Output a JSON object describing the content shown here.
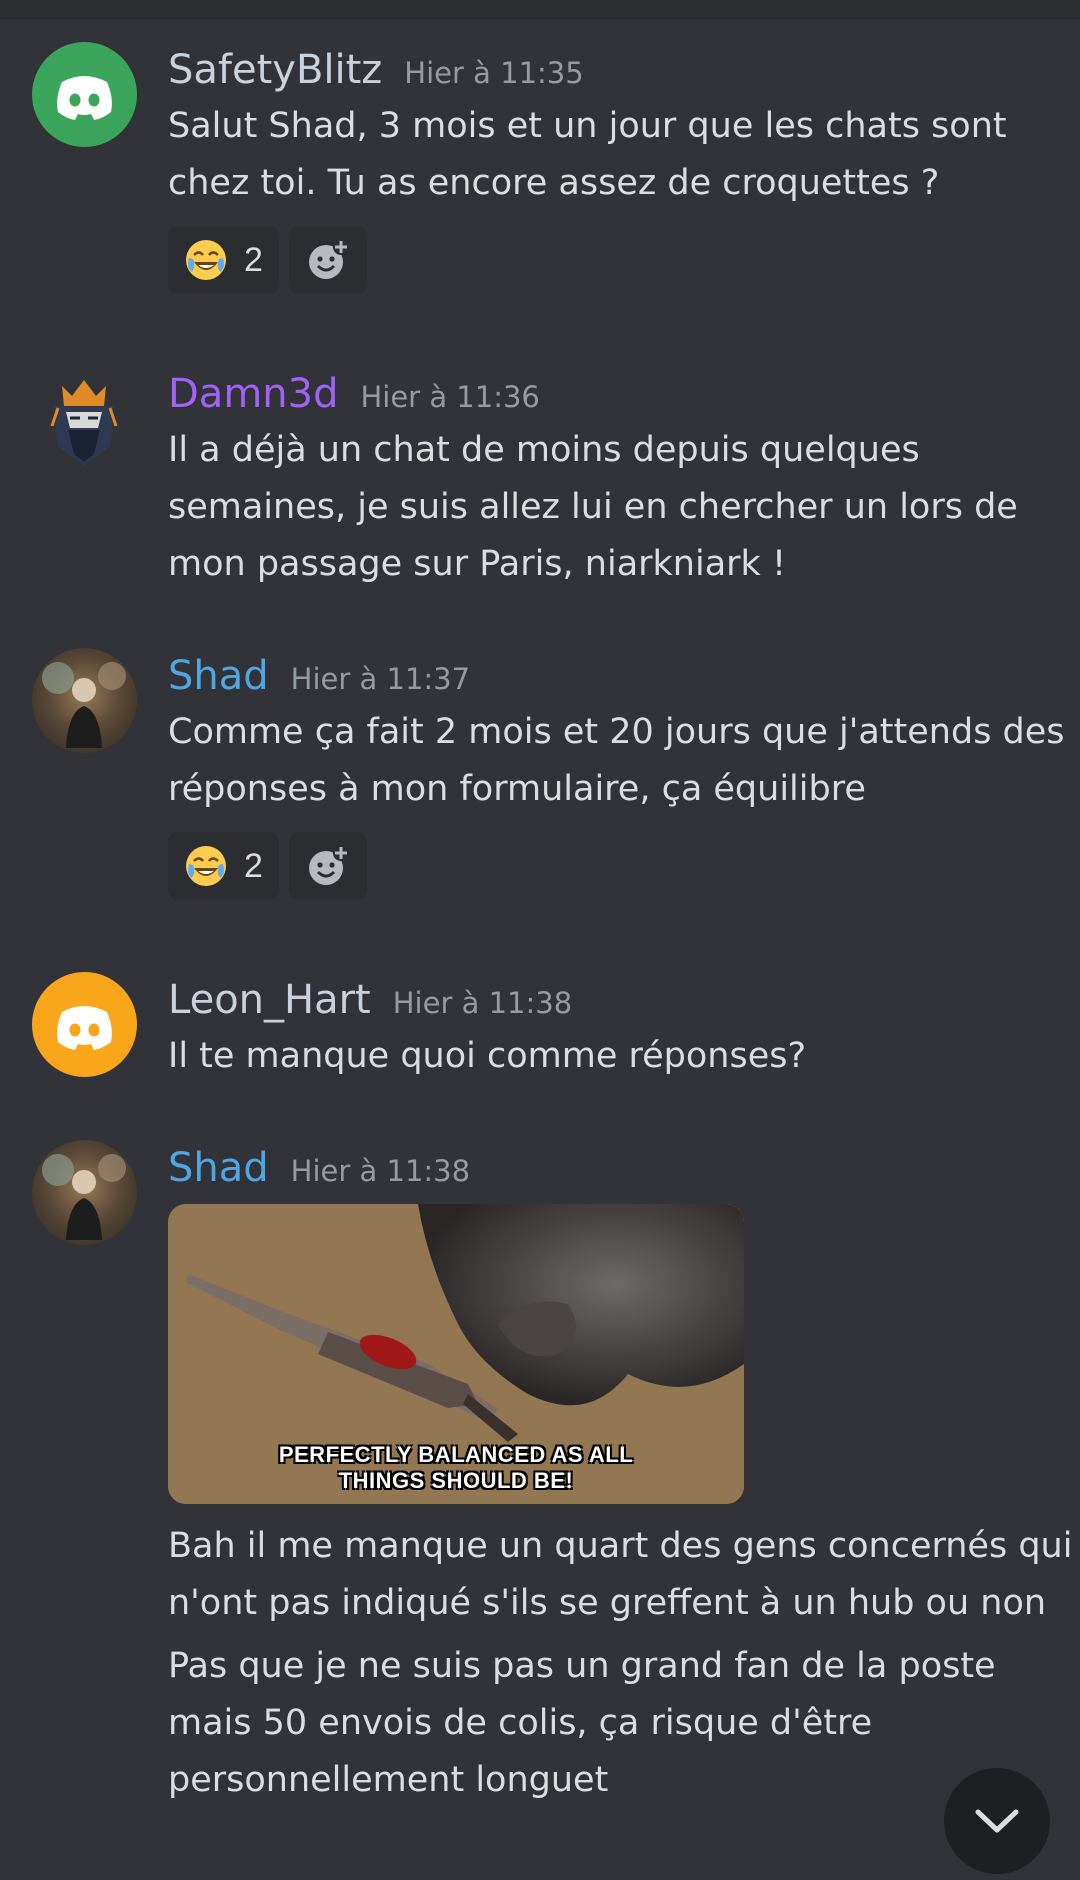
{
  "messages": [
    {
      "username": "SafetyBlitz",
      "username_color": "#c9d1dc",
      "avatar_color": "#3ba55c",
      "timestamp": "Hier à 11:35",
      "lines": [
        "Salut Shad, 3 mois et un jour que les chats sont",
        "chez toi. Tu as encore assez de croquettes ?"
      ],
      "reaction": {
        "emoji": "joy-emoji",
        "count": "2"
      }
    },
    {
      "username": "Damn3d",
      "username_color": "#a162f7",
      "timestamp": "Hier à 11:36",
      "lines": [
        "Il a déjà un chat de moins depuis quelques",
        "semaines, je suis allez lui en chercher un lors de",
        "mon passage sur Paris, niarkniark !"
      ]
    },
    {
      "username": "Shad",
      "username_color": "#4fa6e3",
      "timestamp": "Hier à 11:37",
      "lines": [
        "Comme ça fait 2 mois et 20 jours que j'attends des",
        "réponses à mon formulaire, ça équilibre"
      ],
      "reaction": {
        "emoji": "joy-emoji",
        "count": "2"
      }
    },
    {
      "username": "Leon_Hart",
      "username_color": "#c9d1dc",
      "avatar_color": "#faa61a",
      "timestamp": "Hier à 11:38",
      "lines": [
        "Il te manque quoi comme réponses?"
      ]
    },
    {
      "username": "Shad",
      "username_color": "#4fa6e3",
      "timestamp": "Hier à 11:38",
      "gif_caption": [
        "PERFECTLY BALANCED AS ALL",
        "THINGS SHOULD BE!"
      ],
      "lines": [
        "Bah il me manque un quart des gens concernés qui",
        "n'ont pas indiqué s'ils se greffent à un hub ou non"
      ],
      "lines2": [
        "Pas que je ne suis pas un grand fan de la poste",
        "mais 50 envois de colis, ça risque d'être",
        "personnellement longuet"
      ]
    }
  ],
  "scroll_button_icon": "chevron-down-icon"
}
